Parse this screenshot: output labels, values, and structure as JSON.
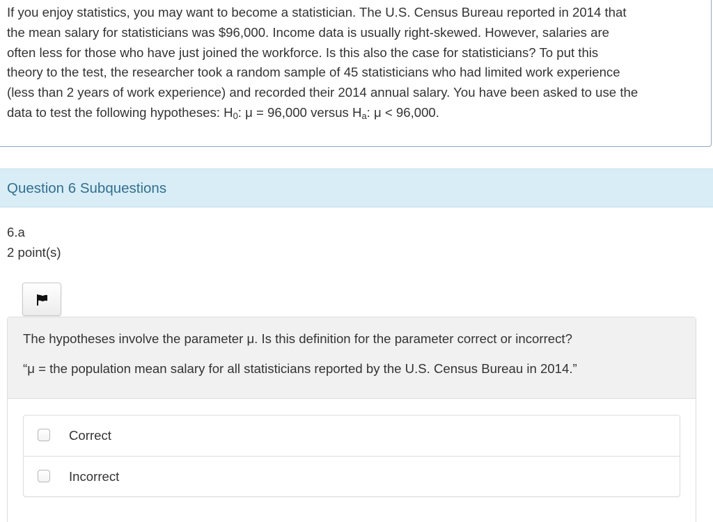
{
  "stem": {
    "line1": "If you enjoy statistics, you may want to become a statistician. The U.S. Census Bureau reported in 2014 that",
    "line2": "the mean salary for statisticians was $96,000.  Income data is usually right-skewed. However, salaries are",
    "line3": "often less for those who have just joined the workforce. Is this also the case for statisticians? To put this",
    "line4": "theory to the test, the researcher took a random sample of 45 statisticians who had limited work experience",
    "line5": "(less than 2 years of work experience) and recorded their 2014 annual salary. You have been asked to use the",
    "line6_before": "data to test the following hypotheses: H",
    "null_subscript": "0",
    "null_statement": ": μ = 96,000 versus H",
    "alt_subscript": "a",
    "alt_statement": ": μ < 96,000."
  },
  "section": {
    "title": "Question 6 Subquestions"
  },
  "subquestion": {
    "number": "6.a",
    "points": "2 point(s)",
    "flag_icon": "flag-icon",
    "prompt": "The hypotheses involve the parameter μ. Is this definition for the parameter correct or incorrect?",
    "definition": "“μ = the population mean salary for all statisticians reported by the U.S. Census Bureau in 2014.”",
    "options": [
      {
        "label": "Correct",
        "checked": false
      },
      {
        "label": "Incorrect",
        "checked": false
      }
    ]
  }
}
